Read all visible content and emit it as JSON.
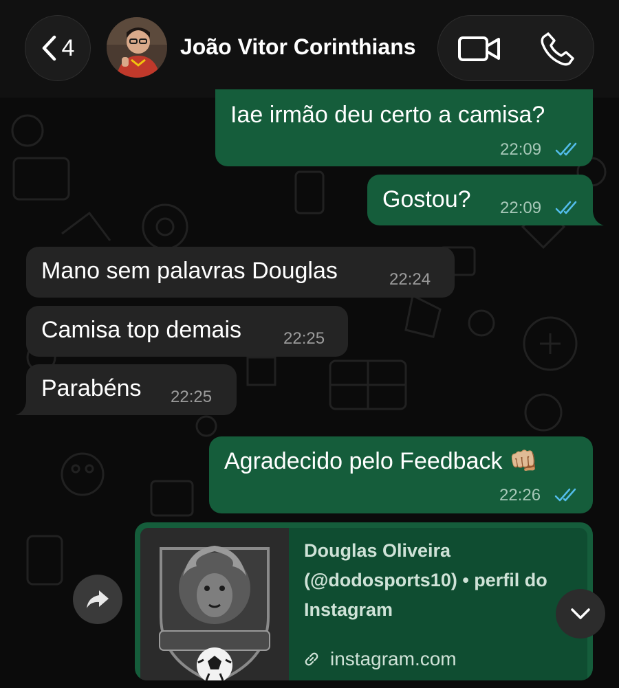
{
  "header": {
    "back_count": "4",
    "contact_name": "João Vitor Corinthians"
  },
  "messages": [
    {
      "direction": "outgoing",
      "text": "Iae irmão deu certo a camisa?",
      "time": "22:09",
      "status": "read"
    },
    {
      "direction": "outgoing",
      "text": "Gostou?",
      "time": "22:09",
      "status": "read"
    },
    {
      "direction": "incoming",
      "text": "Mano sem palavras Douglas",
      "time": "22:24"
    },
    {
      "direction": "incoming",
      "text": "Camisa top demais",
      "time": "22:25"
    },
    {
      "direction": "incoming",
      "text": "Parabéns",
      "time": "22:25"
    },
    {
      "direction": "outgoing",
      "text": "Agradecido pelo Feedback 👊🏼",
      "time": "22:26",
      "status": "read"
    }
  ],
  "link_preview": {
    "title": "Douglas Oliveira (@dodosports10) • perfil do Instagram",
    "domain": "instagram.com",
    "thumbnail": "lion-crest-logo"
  },
  "icons": {
    "back": "chevron-left-icon",
    "video": "video-camera-icon",
    "phone": "phone-icon",
    "forward": "forward-arrow-icon",
    "scroll": "chevron-down-icon",
    "link": "link-icon",
    "read_receipt": "double-check-icon"
  },
  "colors": {
    "outgoing_bubble": "#155d3b",
    "incoming_bubble": "#242424",
    "read_tick": "#53bdeb",
    "background": "#0b0b0b"
  }
}
